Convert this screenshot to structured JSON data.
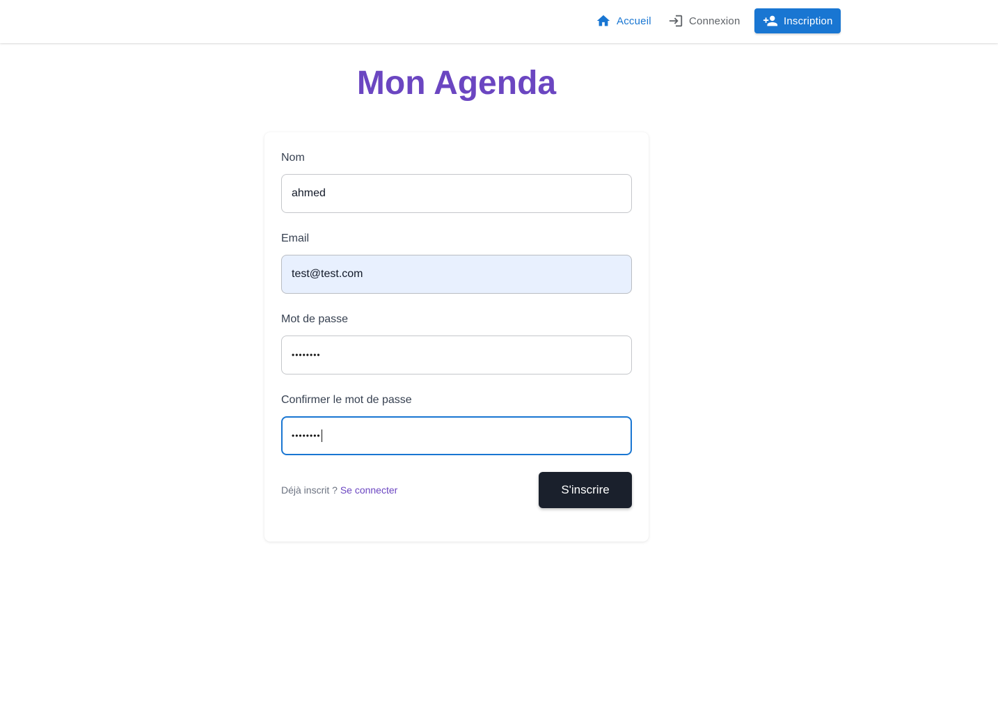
{
  "nav": {
    "accueil": "Accueil",
    "connexion": "Connexion",
    "inscription": "Inscription"
  },
  "title": "Mon Agenda",
  "form": {
    "name_label": "Nom",
    "name_value": "ahmed",
    "email_label": "Email",
    "email_value": "test@test.com",
    "password_label": "Mot de passe",
    "password_value": "••••••••",
    "confirm_label": "Confirmer le mot de passe",
    "confirm_value": "••••••••",
    "already_text": "Déjà inscrit ? ",
    "login_link": "Se connecter",
    "submit_label": "S'inscrire"
  },
  "icons": {
    "accueil": "home-icon",
    "connexion": "login-icon",
    "inscription": "person-add-icon"
  },
  "colors": {
    "primary": "#1976d2",
    "title": "#6b46c1",
    "submit_bg": "#1a202c",
    "autofill_bg": "#e8f0fe"
  }
}
